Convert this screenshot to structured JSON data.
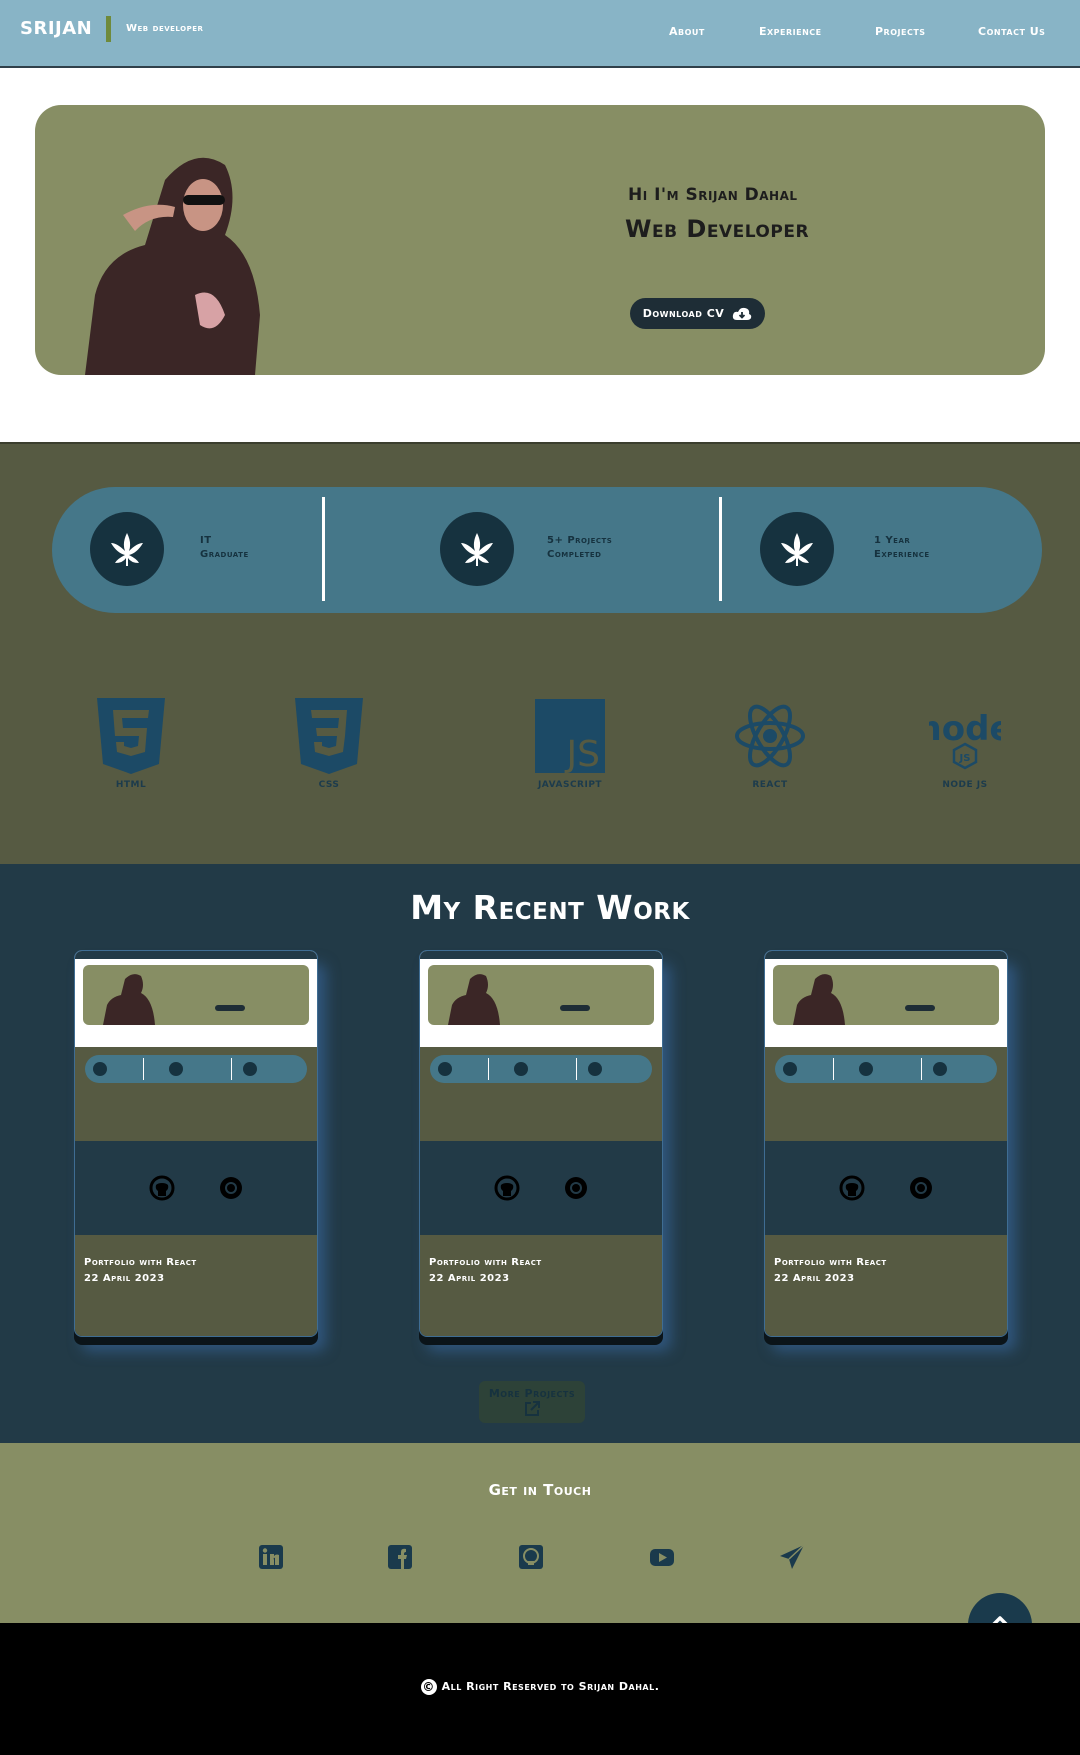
{
  "header": {
    "brand": "SRIJAN",
    "subtitle": "Web developer",
    "nav": [
      "About",
      "Experience",
      "Projects",
      "Contact Us"
    ]
  },
  "hero": {
    "greeting": "Hi I'm Srijan  Dahal",
    "role": "Web Developer",
    "cv_button": "Download CV"
  },
  "stats": [
    {
      "line1": "IT",
      "line2": "Graduate",
      "icon": "leaf-icon"
    },
    {
      "line1": "5+ Projects",
      "line2": "Completed",
      "icon": "leaf-icon"
    },
    {
      "line1": "1 Year",
      "line2": "Experience",
      "icon": "leaf-icon"
    }
  ],
  "skills": [
    {
      "label": "HTML",
      "icon": "html5-icon"
    },
    {
      "label": "CSS",
      "icon": "css3-icon"
    },
    {
      "label": "JAVASCRIPT",
      "icon": "js-icon"
    },
    {
      "label": "REACT",
      "icon": "react-icon"
    },
    {
      "label": "NODE JS",
      "icon": "nodejs-icon"
    }
  ],
  "work": {
    "title": "My Recent Work",
    "projects": [
      {
        "title": "Portfolio with React",
        "date": "22 April 2023"
      },
      {
        "title": "Portfolio with React",
        "date": "22 April 2023"
      },
      {
        "title": "Portfolio with React",
        "date": "22 April 2023"
      }
    ],
    "more_button": "More Projects"
  },
  "contact": {
    "title": "Get in Touch",
    "socials": [
      "linkedin-icon",
      "facebook-icon",
      "github-icon",
      "youtube-icon",
      "send-icon"
    ]
  },
  "footer": {
    "text": "All Right  Reserved to Srijan Dahal."
  },
  "colors": {
    "header_bg": "#88b4c6",
    "olive": "#878e64",
    "dark_olive": "#565a42",
    "teal": "#457789",
    "navy": "#223a47",
    "deep_navy": "#16323f"
  }
}
